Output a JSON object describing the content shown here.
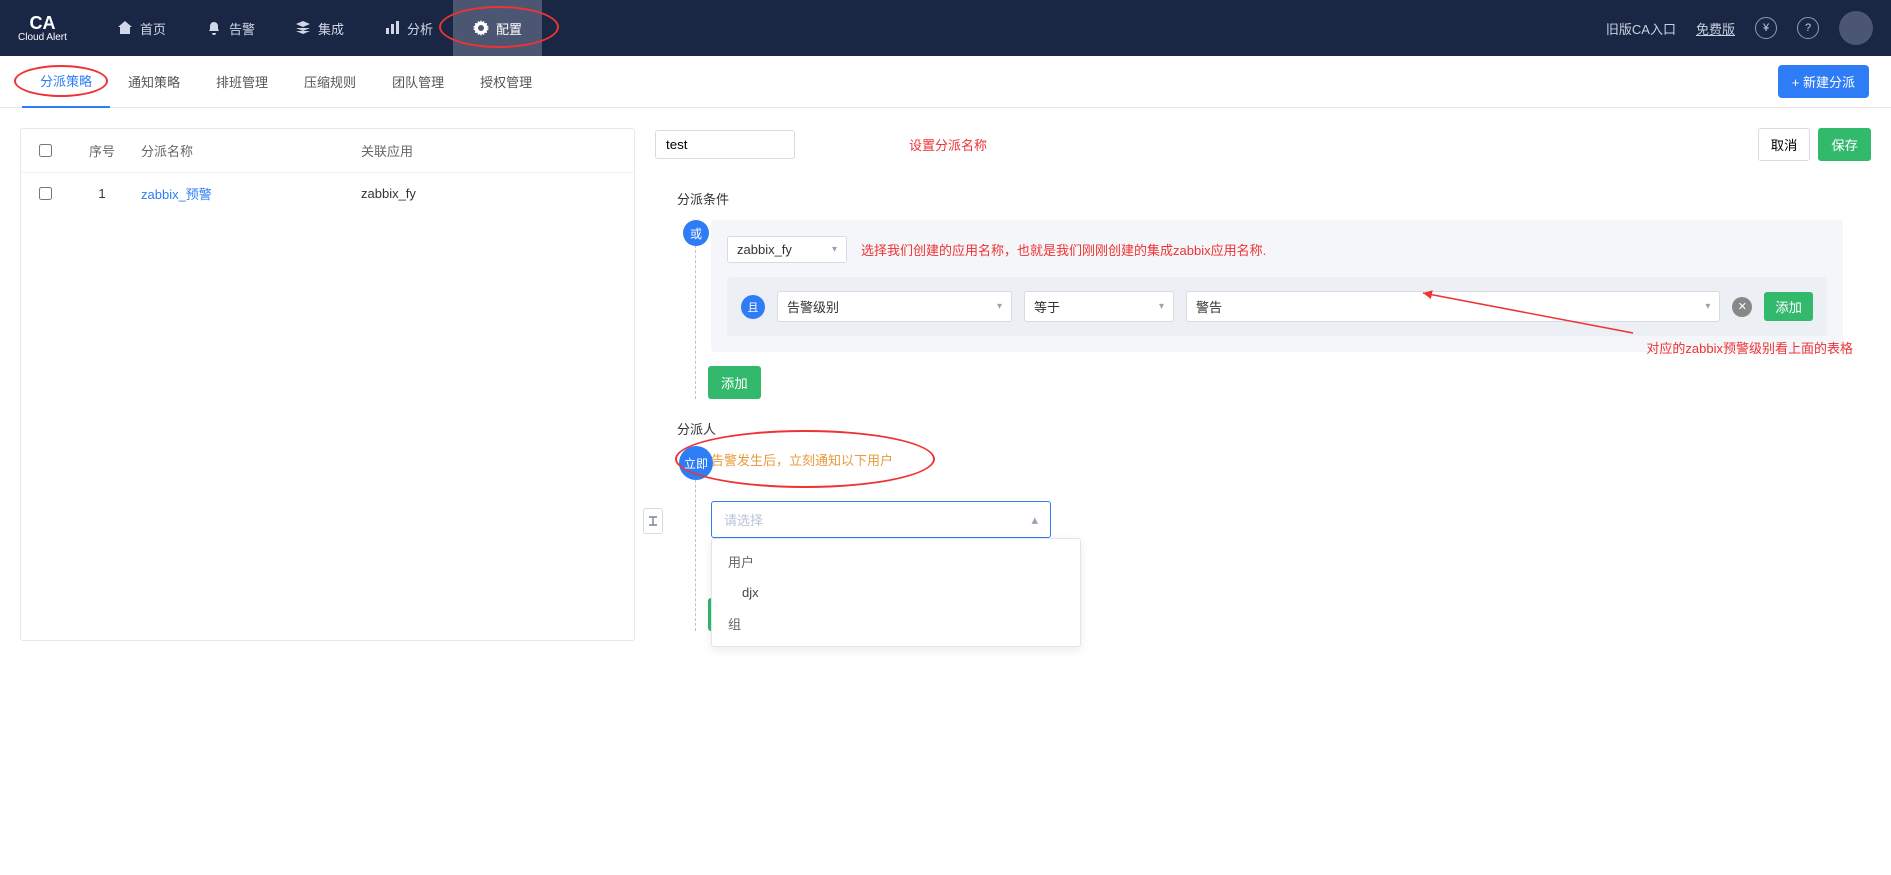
{
  "brand": {
    "title": "CA",
    "sub": "Cloud Alert"
  },
  "nav": {
    "home": "首页",
    "alarm": "告警",
    "integ": "集成",
    "analysis": "分析",
    "config": "配置"
  },
  "topr": {
    "oldentry": "旧版CA入口",
    "free": "免费版",
    "rmb": "¥",
    "q": "?"
  },
  "tabs": {
    "t0": "分派策略",
    "t1": "通知策略",
    "t2": "排班管理",
    "t3": "压缩规则",
    "t4": "团队管理",
    "t5": "授权管理"
  },
  "newbtn": "+  新建分派",
  "table": {
    "h_seq": "序号",
    "h_name": "分派名称",
    "h_app": "关联应用",
    "r1_seq": "1",
    "r1_name": "zabbix_预警",
    "r1_app": "zabbix_fy"
  },
  "title_input": "test",
  "hint_title": "设置分派名称",
  "btn_cancel": "取消",
  "btn_save": "保存",
  "sec_cond": "分派条件",
  "node_or": "或",
  "sel_app": "zabbix_fy",
  "hint_app": "选择我们创建的应用名称，也就是我们刚刚创建的集成zabbix应用名称.",
  "node_and": "且",
  "sel_field": "告警级别",
  "sel_op": "等于",
  "sel_val": "警告",
  "btn_add": "添加",
  "hint_level": "对应的zabbix预警级别看上面的表格",
  "sec_assign": "分派人",
  "node_imm": "立即",
  "warn_txt": "告警发生后，立刻通知以下用户",
  "sel_placeholder": "请选择",
  "dd_user": "用户",
  "dd_djx": "djx",
  "dd_group": "组"
}
